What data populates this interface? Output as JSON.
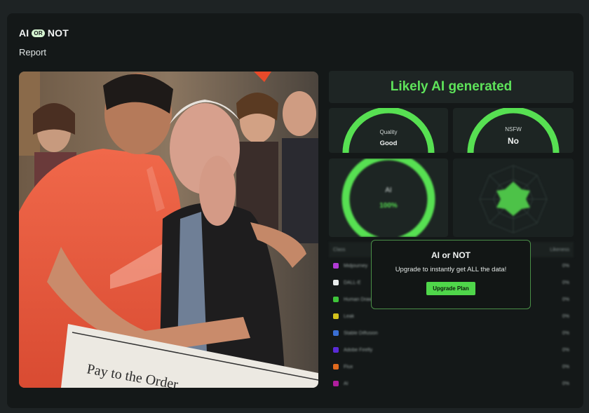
{
  "brand": {
    "ai": "AI",
    "or": "OR",
    "not": "NOT"
  },
  "page": {
    "subtitle": "Report"
  },
  "result": {
    "verdict": "Likely AI generated"
  },
  "quality": {
    "label": "Quality",
    "value": "Good"
  },
  "nsfw": {
    "label": "NSFW",
    "value": "No"
  },
  "ai_score": {
    "label": "AI",
    "value": "100%"
  },
  "photo": {
    "check_text": "Pay to the Order"
  },
  "table": {
    "headers": [
      "Class",
      "Likeness"
    ],
    "rows": [
      {
        "name": "Midjourney",
        "value": "0%",
        "color": "#b23bd6"
      },
      {
        "name": "DALL-E",
        "value": "0%",
        "color": "#e9ecec"
      },
      {
        "name": "Human Drawn",
        "value": "0%",
        "color": "#3ec43a"
      },
      {
        "name": "Leak",
        "value": "0%",
        "color": "#d4c21c"
      },
      {
        "name": "Stable Diffusion",
        "value": "0%",
        "color": "#3a6fd4"
      },
      {
        "name": "Adobe Firefly",
        "value": "0%",
        "color": "#5a2bd6"
      },
      {
        "name": "Flux",
        "value": "0%",
        "color": "#e06a1e"
      },
      {
        "name": "AI",
        "value": "0%",
        "color": "#b01e9e"
      }
    ]
  },
  "upgrade": {
    "title": "AI or NOT",
    "text": "Upgrade to instantly get ALL the data!",
    "button": "Upgrade Plan"
  },
  "colors": {
    "accent": "#5ee35a",
    "gauge": "#57e052",
    "card": "#141818"
  }
}
